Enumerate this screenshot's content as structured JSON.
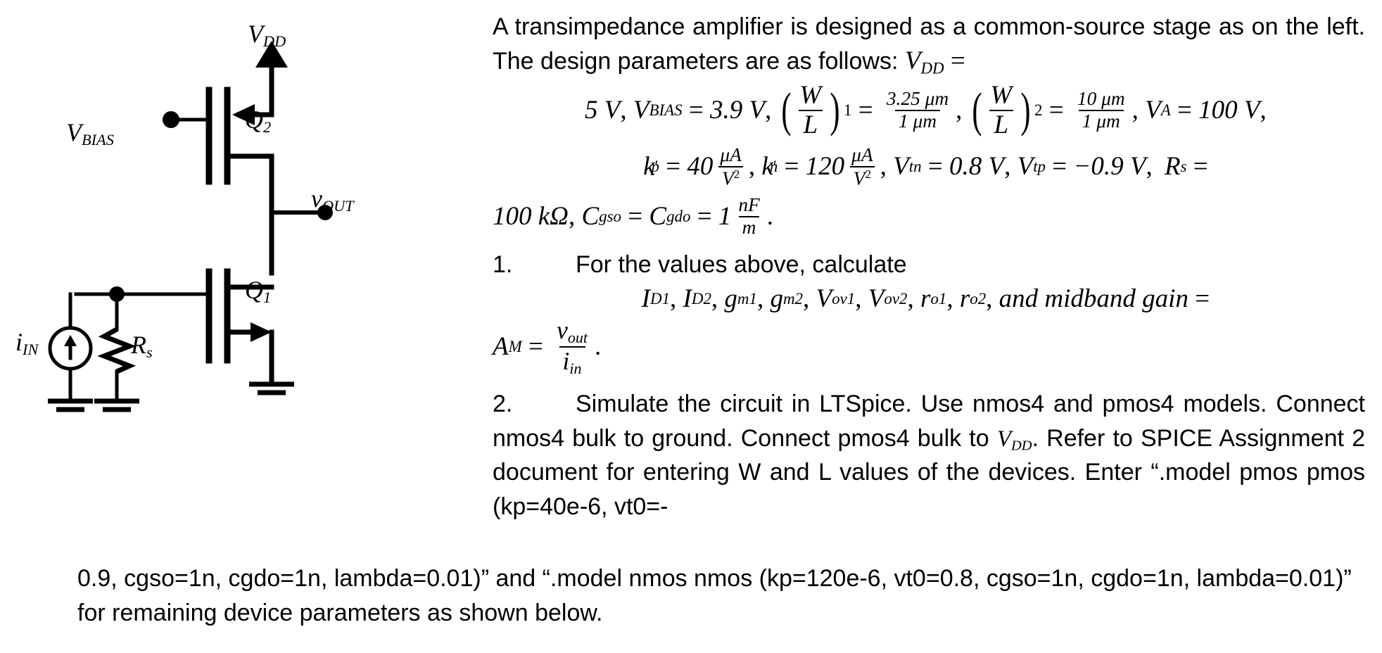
{
  "figure": {
    "labels": {
      "vdd": "V",
      "vdd_sub": "DD",
      "vbias": "V",
      "vbias_sub": "BIAS",
      "q2": "Q",
      "q2_sub": "2",
      "q1": "Q",
      "q1_sub": "1",
      "vout": "v",
      "vout_sub": "OUT",
      "iin": "i",
      "iin_sub": "IN",
      "rs": "R",
      "rs_sub": "s"
    }
  },
  "intro": {
    "line_a": "A transimpedance amplifier is designed as a common-source stage as on the left. The design parameters are as follows: "
  },
  "params": {
    "vdd_name": "V",
    "vdd_sub": "DD",
    "eq1": " = ",
    "vdd_value": "5 V",
    "comma1": ", ",
    "vbias_name": "V",
    "vbias_sub": "BIAS",
    "vbias_value": "3.9 V",
    "wl_num": "W",
    "wl_den": "L",
    "wl1_sub": "1",
    "wl1_value_num": "3.25 μm",
    "wl1_value_den": "1 μm",
    "wl2_sub": "2",
    "wl2_value_num": "10 μm",
    "wl2_value_den": "1 μm",
    "va_name": "V",
    "va_sub": "A",
    "va_value": "100 V",
    "kp_name": "k",
    "kp_prime": "′",
    "kp_sub": "p",
    "kp_value": "40",
    "kp_unit_num": "μA",
    "kp_unit_den": "V",
    "kn_name": "k",
    "kn_sub": "n",
    "kn_value": "120",
    "vtn_name": "V",
    "vtn_sub": "tn",
    "vtn_value": "0.8 V",
    "vtp_name": "V",
    "vtp_sub": "tp",
    "vtp_value": "−0.9 V",
    "rs_name": "R",
    "rs_sub": "s",
    "rs_value": "100 kΩ",
    "cgso_name": "C",
    "cgso_sub": "gso",
    "cgdo_name": "C",
    "cgdo_sub": "gdo",
    "c_value": "1",
    "c_unit_num": "nF",
    "c_unit_den": "m",
    "period": "."
  },
  "items": [
    {
      "number": "1.",
      "text": "For the values above, calculate",
      "math_list": [
        {
          "base": "I",
          "sub": "D1"
        },
        {
          "base": "I",
          "sub": "D2"
        },
        {
          "base": "g",
          "sub": "m1"
        },
        {
          "base": "g",
          "sub": "m2"
        },
        {
          "base": "V",
          "sub": "ov1"
        },
        {
          "base": "V",
          "sub": "ov2"
        },
        {
          "base": "r",
          "sub": "o1"
        },
        {
          "base": "r",
          "sub": "o2"
        }
      ],
      "tail": "and midband gain",
      "am_name": "A",
      "am_sub": "M",
      "am_num": "v",
      "am_num_sub": "out",
      "am_den": "i",
      "am_den_sub": "in",
      "am_period": "."
    },
    {
      "number": "2.",
      "line1": "Simulate the circuit in LTSpice. Use nmos4 and pmos4 models. Connect nmos4 bulk to ground. Connect pmos4 bulk to ",
      "vdd_name": "V",
      "vdd_sub": "DD",
      "line2": ". Refer to SPICE Assignment 2 document for entering W and L values of the devices. Enter “.model pmos pmos (kp=40e-6, vt0=-",
      "line3": "0.9,  cgso=1n, cgdo=1n, lambda=0.01)” and “.model nmos nmos (kp=120e-6, vt0=0.8,  cgso=1n, cgdo=1n, lambda=0.01)” for remaining device parameters as shown below."
    }
  ],
  "colors": {
    "ink": "#000000",
    "page": "#ffffff"
  }
}
